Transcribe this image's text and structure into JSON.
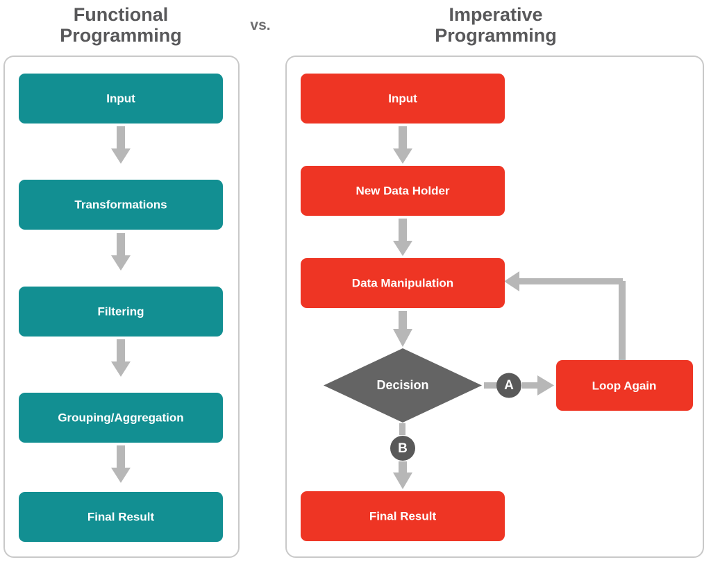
{
  "page": {
    "background_color": "#ffffff",
    "vs_label": "vs."
  },
  "colors": {
    "teal": "#128f92",
    "red": "#ee3524",
    "decision_gray": "#646464",
    "connector_gray": "#595959",
    "arrow_gray": "#b7b7b7",
    "panel_border": "#c9c9c9",
    "title_text": "#58585a",
    "node_text": "#ffffff"
  },
  "left_panel": {
    "title_line1": "Functional",
    "title_line2": "Programming",
    "accent_color": "#128f92",
    "nodes": [
      {
        "id": "fp-input",
        "label": "Input"
      },
      {
        "id": "fp-transformations",
        "label": "Transformations"
      },
      {
        "id": "fp-filtering",
        "label": "Filtering"
      },
      {
        "id": "fp-grouping",
        "label": "Grouping/Aggregation"
      },
      {
        "id": "fp-final-result",
        "label": "Final Result"
      }
    ]
  },
  "right_panel": {
    "title_line1": "Imperative",
    "title_line2": "Programming",
    "accent_color": "#ee3524",
    "nodes": [
      {
        "id": "ip-input",
        "label": "Input"
      },
      {
        "id": "ip-new-data-holder",
        "label": "New Data Holder"
      },
      {
        "id": "ip-data-manipulation",
        "label": "Data Manipulation"
      },
      {
        "id": "ip-loop-again",
        "label": "Loop Again"
      },
      {
        "id": "ip-final-result",
        "label": "Final Result"
      }
    ],
    "decision": {
      "id": "ip-decision",
      "label": "Decision"
    },
    "connectors": [
      {
        "id": "connector-a",
        "label": "A"
      },
      {
        "id": "connector-b",
        "label": "B"
      }
    ]
  },
  "chart_data": {
    "type": "diagram",
    "title": "Functional Programming vs. Imperative Programming",
    "flows": [
      {
        "name": "Functional Programming",
        "color": "#128f92",
        "steps": [
          "Input",
          "Transformations",
          "Filtering",
          "Grouping/Aggregation",
          "Final Result"
        ],
        "edges": [
          [
            "Input",
            "Transformations"
          ],
          [
            "Transformations",
            "Filtering"
          ],
          [
            "Filtering",
            "Grouping/Aggregation"
          ],
          [
            "Grouping/Aggregation",
            "Final Result"
          ]
        ]
      },
      {
        "name": "Imperative Programming",
        "color": "#ee3524",
        "steps": [
          "Input",
          "New Data Holder",
          "Data Manipulation",
          "Decision",
          "Loop Again",
          "Final Result"
        ],
        "edges": [
          [
            "Input",
            "New Data Holder"
          ],
          [
            "New Data Holder",
            "Data Manipulation"
          ],
          [
            "Data Manipulation",
            "Decision"
          ],
          [
            "Decision",
            "Loop Again",
            "A"
          ],
          [
            "Loop Again",
            "Data Manipulation"
          ],
          [
            "Decision",
            "Final Result",
            "B"
          ]
        ]
      }
    ]
  }
}
